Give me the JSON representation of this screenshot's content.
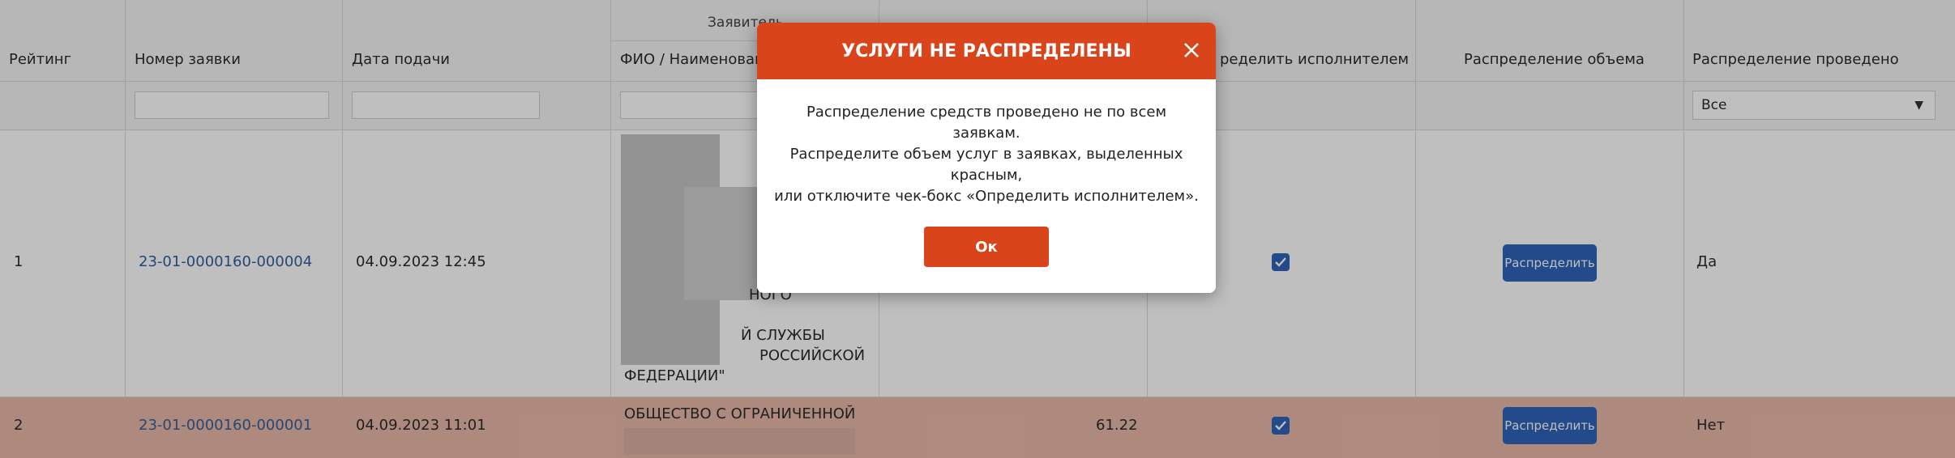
{
  "table": {
    "group_header": "Заявитель",
    "headers": {
      "rating": "Рейтинг",
      "app_number": "Номер заявки",
      "submit_date": "Дата подачи",
      "fio": "ФИО / Наименован",
      "determine_executor": "ределить исполнителем",
      "volume_distribution": "Распределение объема",
      "distribution_done": "Распределение проведено"
    },
    "filter": {
      "select_value": "Все"
    },
    "rows": [
      {
        "rating": "1",
        "number": "23-01-0000160-000004",
        "date": "04.09.2023 12:45",
        "applicant_lines": [
          "НОГО",
          "Й СЛУЖБЫ",
          "РОССИЙСКОЙ",
          "ФЕДЕРАЦИИ\""
        ],
        "value": "",
        "checked": true,
        "button": "Распределить",
        "done": "Да"
      },
      {
        "rating": "2",
        "number": "23-01-0000160-000001",
        "date": "04.09.2023 11:01",
        "applicant_lines": [
          "ОБЩЕСТВО С ОГРАНИЧЕННОЙ"
        ],
        "value": "61.22",
        "checked": true,
        "button": "Распределить",
        "done": "Нет"
      }
    ],
    "colors": {
      "highlight_row": "#e8b9a8",
      "accent_blue": "#2f63b8"
    }
  },
  "modal": {
    "title": "УСЛУГИ НЕ РАСПРЕДЕЛЕНЫ",
    "body_lines": [
      "Распределение средств проведено не по всем",
      "заявкам.",
      "Распределите объем услуг в заявках, выделенных",
      "красным,",
      "или отключите чек-бокс «Определить исполнителем»."
    ],
    "ok": "Ок",
    "header_color": "#d9441a"
  },
  "icons": {
    "close": "close-icon",
    "check": "check-icon",
    "dropdown": "chevron-down-icon"
  }
}
